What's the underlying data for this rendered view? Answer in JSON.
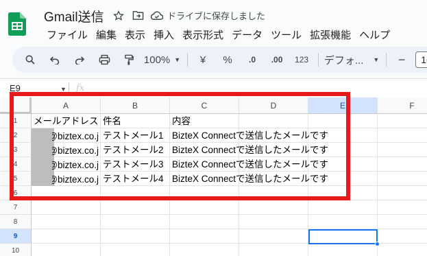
{
  "doc": {
    "title": "Gmail送信",
    "save_status": "ドライブに保存しました"
  },
  "menu": [
    "ファイル",
    "編集",
    "表示",
    "挿入",
    "表示形式",
    "データ",
    "ツール",
    "拡張機能",
    "ヘルプ"
  ],
  "toolbar": {
    "zoom": "100%",
    "currency": "¥",
    "percent": "%",
    "dec_decrease": ".0",
    "dec_increase": ".00",
    "number_format": "123",
    "font": "デフォ...",
    "font_size": "10",
    "minus": "−"
  },
  "formula": {
    "cell_ref": "E9",
    "fx": "fx"
  },
  "columns": [
    "A",
    "B",
    "C",
    "D",
    "E",
    "F"
  ],
  "rows": [
    "1",
    "2",
    "3",
    "4",
    "5",
    "6",
    "7",
    "8",
    "9",
    "10"
  ],
  "cells": {
    "header": [
      "メールアドレス",
      "件名",
      "内容"
    ],
    "email_suffix": "@biztex.co.j",
    "data": [
      {
        "email": "@biztex.co.j",
        "subject": "テストメール1",
        "body": "BizteX Connectで送信したメールです"
      },
      {
        "email": "@biztex.co.j",
        "subject": "テストメール2",
        "body": "BizteX Connectで送信したメールです"
      },
      {
        "email": "@biztex.co.j",
        "subject": "テストメール3",
        "body": "BizteX Connectで送信したメールです"
      },
      {
        "email": "@biztex.co.j",
        "subject": "テストメール4",
        "body": "BizteX Connectで送信したメールです"
      }
    ]
  },
  "colors": {
    "annotation": "#e51b1b",
    "selection": "#1a73e8",
    "sheets_green": "#0f9d58"
  },
  "selected_cell": "E9"
}
